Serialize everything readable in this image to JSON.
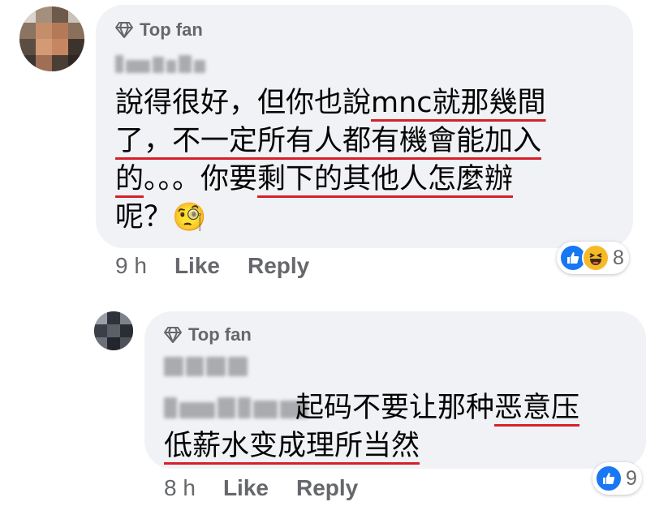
{
  "colors": {
    "bubble_bg": "#f0f2f5",
    "meta_text": "#65676b",
    "like_blue": "#1877f2",
    "haha_yellow": "#f7b928",
    "underline_red": "#d8202a"
  },
  "comments": [
    {
      "badge_icon": "diamond-icon",
      "badge": "Top fan",
      "text_lines": [
        [
          {
            "t": "說得很好，但你也說"
          },
          {
            "t": "mnc就那幾間",
            "u": true
          }
        ],
        [
          {
            "t": "了，不一定所有人都有機會能加入",
            "u": true
          }
        ],
        [
          {
            "t": "的",
            "u": true
          },
          {
            "t": "。。。你要"
          },
          {
            "t": "剩下的其他人怎麼辦",
            "u": true
          }
        ],
        [
          {
            "t": "呢？"
          },
          {
            "t": "🧐",
            "emoji": "monocle-face-emoji"
          }
        ]
      ],
      "time": "9 h",
      "like_label": "Like",
      "reply_label": "Reply",
      "reactions": [
        "like-icon",
        "haha-icon"
      ],
      "reaction_count": "8"
    },
    {
      "badge_icon": "diamond-icon",
      "badge": "Top fan",
      "text_lines": [
        [
          {
            "t": "起码不要让那种"
          },
          {
            "t": "恶意压",
            "u": true
          }
        ],
        [
          {
            "t": "低薪水变成理所当然",
            "u": true
          }
        ]
      ],
      "time": "8 h",
      "like_label": "Like",
      "reply_label": "Reply",
      "reactions": [
        "like-icon"
      ],
      "reaction_count": "9"
    }
  ]
}
